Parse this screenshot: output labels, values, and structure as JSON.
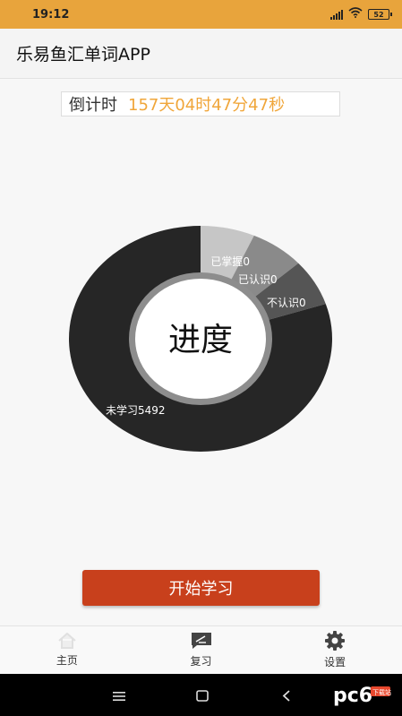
{
  "status_bar": {
    "time": "19:12",
    "battery": "52"
  },
  "app_title": "乐易鱼汇单词APP",
  "countdown": {
    "label": "倒计时",
    "value": "157天04时47分47秒"
  },
  "chart_data": {
    "type": "pie",
    "center_label": "进度",
    "categories": [
      "已掌握",
      "已认识",
      "不认识",
      "未学习"
    ],
    "values": [
      0,
      0,
      0,
      5492
    ],
    "labels": [
      "已掌握0",
      "已认识0",
      "不认识0",
      "未学习5492"
    ],
    "colors": [
      "#c6c6c6",
      "#8a8a8a",
      "#555555",
      "#262626"
    ]
  },
  "start_button": {
    "label": "开始学习"
  },
  "bottom_nav": [
    {
      "label": "主页",
      "icon": "home-icon"
    },
    {
      "label": "复习",
      "icon": "review-icon"
    },
    {
      "label": "设置",
      "icon": "gear-icon"
    }
  ],
  "system_nav": {
    "icons": [
      "menu-icon",
      "home-square-icon",
      "back-icon"
    ]
  },
  "watermark": {
    "text": "pc6",
    "subtext": "下载站"
  },
  "colors": {
    "status_bar": "#e8a43c",
    "accent": "#c8401c",
    "countdown_value": "#f0a63a"
  }
}
